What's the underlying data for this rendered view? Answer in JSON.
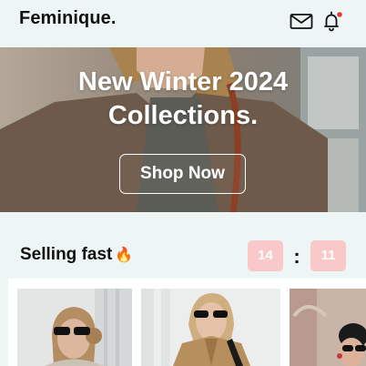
{
  "header": {
    "brand": "Feminique.",
    "mail_icon": "mail-icon",
    "bell_icon": "bell-icon",
    "notification_dot_color": "#e53935"
  },
  "hero": {
    "title_line1": "New Winter 2024",
    "title_line2": "Collections.",
    "button_label": "Shop Now"
  },
  "selling_fast": {
    "title": "Selling fast",
    "emoji": "🔥",
    "timer": {
      "hours": "14",
      "separator": ":",
      "minutes": "11"
    }
  },
  "products": [
    {
      "image": "woman-sunglasses-bun-photo"
    },
    {
      "image": "woman-trench-coat-sunglasses-photo"
    },
    {
      "image": "woman-beret-sunglasses-photo"
    }
  ],
  "colors": {
    "background": "#eef5f5",
    "timer_bg": "#f8c9c8",
    "text": "#111111"
  }
}
